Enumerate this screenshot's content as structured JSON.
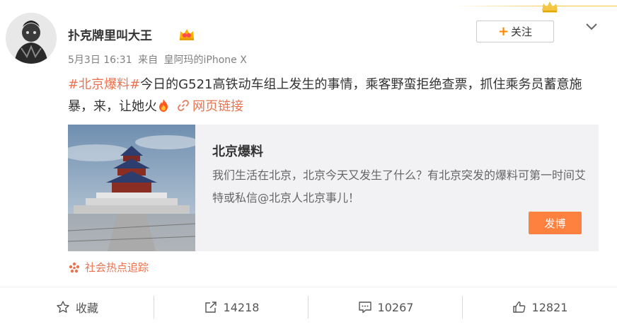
{
  "user": {
    "name": "扑克牌里叫大王",
    "post_date": "5月3日 16:31",
    "source_prefix": "来自",
    "source_device": "皇阿玛的iPhone X"
  },
  "follow_button": {
    "label": "关注"
  },
  "post": {
    "topic": "#北京爆料#",
    "body": "今日的G521高铁动车组上发生的事情，乘客野蛮拒绝查票，抓住乘务员蓄意施暴，来，让她火",
    "link_label": "网页链接"
  },
  "preview_card": {
    "title": "北京爆料",
    "description": "我们生活在北京，北京今天又发生了什么？有北京突发的爆料可第一时间艾特或私信@北京人北京事儿！",
    "button_label": "发博"
  },
  "source_tag": {
    "label": "社会热点追踪"
  },
  "actions": {
    "favorite_label": "收藏",
    "repost_count": "14218",
    "comment_count": "10267",
    "like_count": "12821"
  },
  "colors": {
    "accent": "#eb7350",
    "follow_plus": "#ff8200",
    "post_button": "#ff8140"
  }
}
